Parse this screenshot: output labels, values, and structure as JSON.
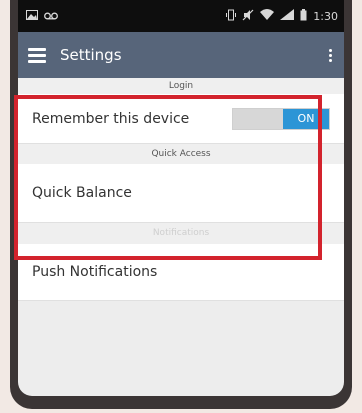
{
  "status_bar": {
    "left_icons": [
      "image-icon",
      "voicemail-icon"
    ],
    "right_icons": [
      "vibrate-icon",
      "mute-icon",
      "wifi-icon",
      "signal-icon",
      "battery-icon"
    ],
    "time": "1:30"
  },
  "toolbar": {
    "title": "Settings",
    "menu_icon": "hamburger-menu-icon",
    "overflow_icon": "overflow-menu-icon",
    "color": "#57657a"
  },
  "sections": {
    "login": {
      "header": "Login",
      "remember_label": "Remember this device",
      "toggle_on_label": "ON",
      "toggle_state": "on"
    },
    "quick_access": {
      "header": "Quick Access",
      "quick_balance_label": "Quick Balance"
    },
    "notifications": {
      "header": "Notifications",
      "push_label": "Push Notifications"
    }
  },
  "colors": {
    "highlight": "#d3232d",
    "toggle_accent": "#2c95d6"
  }
}
